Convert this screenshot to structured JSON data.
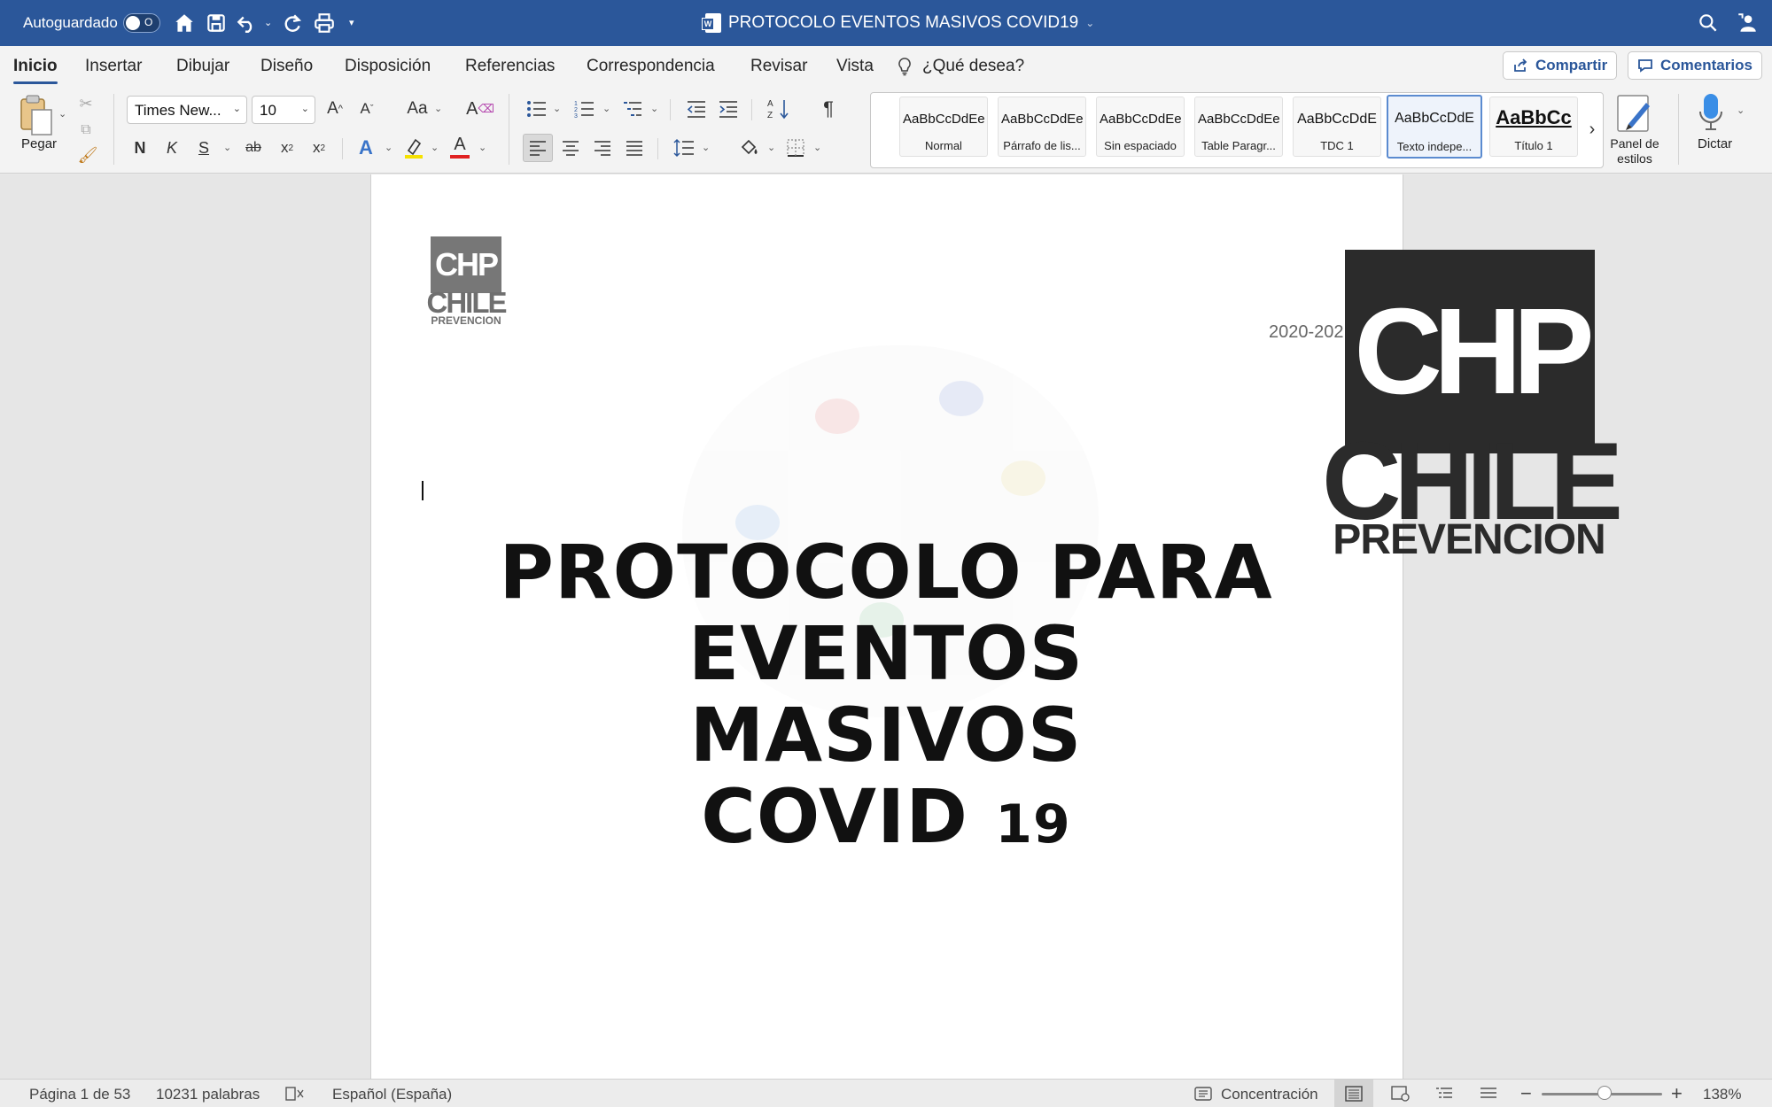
{
  "titlebar": {
    "autosave_label": "Autoguardado",
    "autosave_state": "O",
    "document_title": "PROTOCOLO EVENTOS MASIVOS COVID19",
    "icons": [
      "home-icon",
      "save-icon",
      "undo-icon",
      "redo-icon",
      "print-icon",
      "customize-icon",
      "search-icon",
      "share-person-icon"
    ]
  },
  "menu": {
    "tabs": [
      {
        "label": "Inicio",
        "active": true
      },
      {
        "label": "Insertar"
      },
      {
        "label": "Dibujar"
      },
      {
        "label": "Diseño"
      },
      {
        "label": "Disposición"
      },
      {
        "label": "Referencias"
      },
      {
        "label": "Correspondencia"
      },
      {
        "label": "Revisar"
      },
      {
        "label": "Vista"
      }
    ],
    "tell_me": "¿Qué desea?",
    "share_label": "Compartir",
    "comments_label": "Comentarios"
  },
  "ribbon": {
    "paste_label": "Pegar",
    "font_name": "Times New...",
    "font_size": "10",
    "grow_font": "A",
    "shrink_font": "A",
    "change_case": "Aa",
    "bold": "N",
    "italic": "K",
    "underline": "S",
    "strikethrough": "ab",
    "subscript": "x",
    "superscript": "x",
    "text_effects": "A",
    "font_color": "A",
    "pilcrow": "¶",
    "styles": [
      {
        "preview": "AaBbCcDdEe",
        "name": "Normal"
      },
      {
        "preview": "AaBbCcDdEe",
        "name": "Párrafo de lis..."
      },
      {
        "preview": "AaBbCcDdEe",
        "name": "Sin espaciado"
      },
      {
        "preview": "AaBbCcDdEe",
        "name": "Table Paragr..."
      },
      {
        "preview": "AaBbCcDdE",
        "name": "TDC 1"
      },
      {
        "preview": "AaBbCcDdE",
        "name": "Texto indepe...",
        "selected": true
      },
      {
        "preview": "AaBbCc",
        "name": "Título 1",
        "big": true
      }
    ],
    "styles_more": "›",
    "styles_pane_label_1": "Panel de",
    "styles_pane_label_2": "estilos",
    "dictate_label": "Dictar",
    "accent_color": "#2b579a"
  },
  "document": {
    "logo_small": {
      "top": "CHP",
      "middle": "CHILE",
      "bottom": "PREVENCION"
    },
    "logo_big": {
      "top": "CHP",
      "middle": "CHILE",
      "bottom": "PREVENCION"
    },
    "year_text": "2020-202",
    "title_line1": "PROTOCOLO PARA",
    "title_line2": "EVENTOS MASIVOS",
    "title_line3_main": "COVID",
    "title_line3_num": "19"
  },
  "status": {
    "page": "Página 1 de 53",
    "words": "10231 palabras",
    "language": "Español (España)",
    "focus": "Concentración",
    "zoom_minus": "−",
    "zoom_plus": "+",
    "zoom_percent": "138%",
    "zoom_level_fraction": 0.52
  }
}
